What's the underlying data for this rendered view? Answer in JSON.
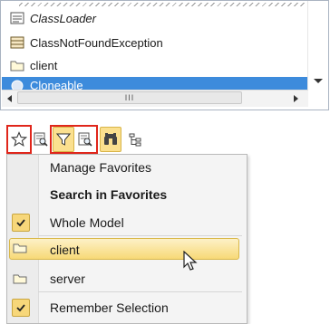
{
  "tree": {
    "items": [
      {
        "label": "ClassLoader",
        "icon": "interface-icon"
      },
      {
        "label": "ClassNotFoundException",
        "icon": "class-icon"
      },
      {
        "label": "client",
        "icon": "folder-icon"
      },
      {
        "label": "Cloneable",
        "icon": "interface-icon"
      }
    ]
  },
  "scrollbar": {
    "thumb_label": "III"
  },
  "toolbar": {
    "favorites_icon": "star-icon",
    "search_icon": "search-model-icon",
    "filter_icon": "filter-icon",
    "filter_search_icon": "search-filter-icon",
    "binoculars_icon": "binoculars-icon",
    "expand_icon": "tree-expand-icon"
  },
  "menu": {
    "manage_favorites": "Manage Favorites",
    "search_in_favorites": "Search in Favorites",
    "whole_model": "Whole Model",
    "client": "client",
    "server": "server",
    "remember_selection": "Remember Selection"
  },
  "colors": {
    "selection": "#3d8bdc",
    "highlight": "#f7d977",
    "red_outline": "#e0261b"
  }
}
